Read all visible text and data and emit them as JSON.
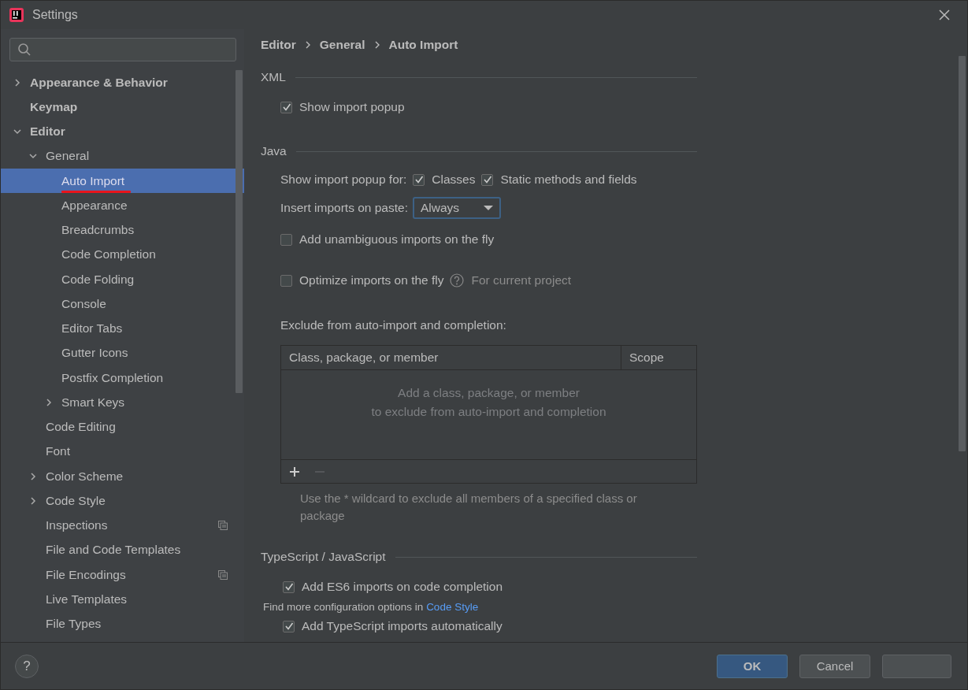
{
  "window": {
    "title": "Settings"
  },
  "sidebar": {
    "items": [
      {
        "label": "Appearance & Behavior",
        "kind": "folder",
        "expanded": false,
        "selected": false,
        "project_scope": false
      },
      {
        "label": "Keymap",
        "kind": "page",
        "selected": false,
        "project_scope": false
      },
      {
        "label": "Editor",
        "kind": "folder",
        "expanded": true,
        "selected": false,
        "project_scope": false,
        "children": [
          {
            "label": "General",
            "kind": "folder",
            "expanded": true,
            "selected": false,
            "project_scope": false,
            "children": [
              {
                "label": "Auto Import",
                "kind": "page",
                "selected": true,
                "project_scope": false
              },
              {
                "label": "Appearance",
                "kind": "page",
                "selected": false,
                "project_scope": false
              },
              {
                "label": "Breadcrumbs",
                "kind": "page",
                "selected": false,
                "project_scope": false
              },
              {
                "label": "Code Completion",
                "kind": "page",
                "selected": false,
                "project_scope": false
              },
              {
                "label": "Code Folding",
                "kind": "page",
                "selected": false,
                "project_scope": false
              },
              {
                "label": "Console",
                "kind": "page",
                "selected": false,
                "project_scope": false
              },
              {
                "label": "Editor Tabs",
                "kind": "page",
                "selected": false,
                "project_scope": false
              },
              {
                "label": "Gutter Icons",
                "kind": "page",
                "selected": false,
                "project_scope": false
              },
              {
                "label": "Postfix Completion",
                "kind": "page",
                "selected": false,
                "project_scope": false
              },
              {
                "label": "Smart Keys",
                "kind": "folder",
                "expanded": false,
                "selected": false,
                "project_scope": false
              }
            ]
          },
          {
            "label": "Code Editing",
            "kind": "page",
            "selected": false,
            "project_scope": false
          },
          {
            "label": "Font",
            "kind": "page",
            "selected": false,
            "project_scope": false
          },
          {
            "label": "Color Scheme",
            "kind": "folder",
            "expanded": false,
            "selected": false,
            "project_scope": false
          },
          {
            "label": "Code Style",
            "kind": "folder",
            "expanded": false,
            "selected": false,
            "project_scope": false
          },
          {
            "label": "Inspections",
            "kind": "page",
            "selected": false,
            "project_scope": true
          },
          {
            "label": "File and Code Templates",
            "kind": "page",
            "selected": false,
            "project_scope": false
          },
          {
            "label": "File Encodings",
            "kind": "page",
            "selected": false,
            "project_scope": true
          },
          {
            "label": "Live Templates",
            "kind": "page",
            "selected": false,
            "project_scope": false
          },
          {
            "label": "File Types",
            "kind": "page",
            "selected": false,
            "project_scope": false
          }
        ]
      }
    ]
  },
  "breadcrumb": [
    "Editor",
    "General",
    "Auto Import"
  ],
  "sections": [
    {
      "title": "XML",
      "rows": [
        {
          "kind": "checkbox",
          "label": "Show import popup",
          "checked": true
        }
      ]
    },
    {
      "title": "Java",
      "rows": [
        {
          "kind": "checkgroup",
          "label": "Show import popup for:",
          "options": [
            {
              "label": "Classes",
              "checked": true
            },
            {
              "label": "Static methods and fields",
              "checked": true
            }
          ]
        },
        {
          "kind": "dropdown",
          "label": "Insert imports on paste:",
          "value": "Always"
        },
        {
          "kind": "checkbox",
          "label": "Add unambiguous imports on the fly",
          "checked": false
        },
        {
          "kind": "checkbox",
          "label": "Optimize imports on the fly",
          "checked": false,
          "hint": "For current project"
        },
        {
          "kind": "table",
          "label": "Exclude from auto-import and completion:",
          "columns": [
            "Class, package, or member",
            "Scope"
          ],
          "empty_text": [
            "Add a class, package, or member",
            "to exclude from auto-import and completion"
          ],
          "remove_disabled": true,
          "note": "Use the * wildcard to exclude all members of a specified class or package"
        }
      ]
    },
    {
      "title": "TypeScript / JavaScript",
      "rows": [
        {
          "kind": "checkbox",
          "label": "Add ES6 imports on code completion",
          "checked": true
        },
        {
          "kind": "note",
          "text": "Find more configuration options in",
          "link": "Code Style"
        },
        {
          "kind": "checkbox",
          "label": "Add TypeScript imports automatically",
          "checked": true
        }
      ]
    }
  ],
  "footer": {
    "help": "?",
    "buttons": [
      {
        "label": "OK",
        "primary": true
      },
      {
        "label": "Cancel",
        "primary": false
      },
      {
        "primary": false
      }
    ]
  }
}
